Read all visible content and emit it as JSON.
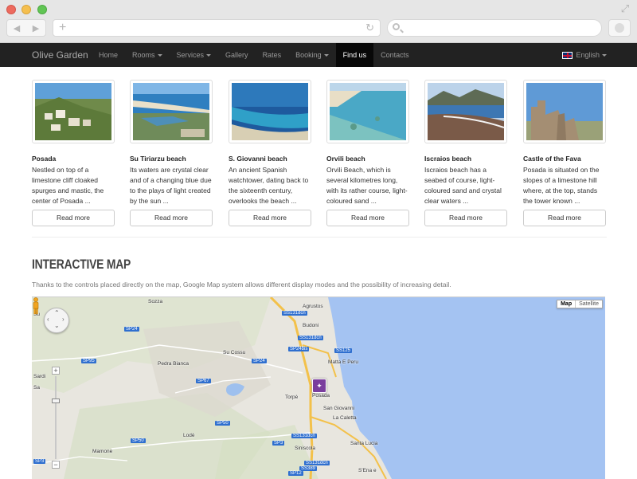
{
  "browser": {
    "nav_back": "◀",
    "nav_forward": "▶",
    "url_plus": "+",
    "reload_icon": "↻"
  },
  "navbar": {
    "brand": "Olive Garden",
    "items": [
      {
        "label": "Home",
        "dropdown": false,
        "active": false
      },
      {
        "label": "Rooms",
        "dropdown": true,
        "active": false
      },
      {
        "label": "Services",
        "dropdown": true,
        "active": false
      },
      {
        "label": "Gallery",
        "dropdown": false,
        "active": false
      },
      {
        "label": "Rates",
        "dropdown": false,
        "active": false
      },
      {
        "label": "Booking",
        "dropdown": true,
        "active": false
      },
      {
        "label": "Find us",
        "dropdown": false,
        "active": true
      },
      {
        "label": "Contacts",
        "dropdown": false,
        "active": false
      }
    ],
    "language": "English"
  },
  "cards": [
    {
      "title": "Posada",
      "text": "Nestled on top of a limestone cliff cloaked spurges and mastic, the center of Posada ...",
      "button": "Read more",
      "image": "hill-village"
    },
    {
      "title": "Su Tiriarzu beach",
      "text": "Its waters are crystal clear and of a changing blue due to the plays of light created by the sun ...",
      "button": "Read more",
      "image": "lagoon-beach"
    },
    {
      "title": "S. Giovanni beach",
      "text": "An ancient Spanish watchtower, dating back to the sixteenth century, overlooks the beach ...",
      "button": "Read more",
      "image": "sea-shore"
    },
    {
      "title": "Orvili beach",
      "text": "Orvili Beach, which is several kilometres long, with its rather course, light-coloured sand ...",
      "button": "Read more",
      "image": "clear-water"
    },
    {
      "title": "Iscraios beach",
      "text": "Iscraios beach has a seabed of course, light-coloured sand and crystal clear waters ...",
      "button": "Read more",
      "image": "mountain-beach"
    },
    {
      "title": "Castle of the Fava",
      "text": "Posada is situated on the slopes of a limestone hill where, at the top, stands the tower known ...",
      "button": "Read more",
      "image": "castle-ruins"
    }
  ],
  "map_section": {
    "title": "INTERACTIVE MAP",
    "subtitle": "Thanks to the controls placed directly on the map, Google Map system allows different display modes and the possibility of increasing detail.",
    "map_type": {
      "map": "Map",
      "satellite": "Satellite"
    },
    "zoom_in": "+",
    "zoom_out": "−",
    "places": [
      {
        "label": "Sozza"
      },
      {
        "label": "Agrustos"
      },
      {
        "label": "Budoni"
      },
      {
        "label": "Su Cossu"
      },
      {
        "label": "Pedra Bianca"
      },
      {
        "label": "Matta E Peru"
      },
      {
        "label": "Torpè"
      },
      {
        "label": "Posada"
      },
      {
        "label": "San Giovanni"
      },
      {
        "label": "La Caletta"
      },
      {
        "label": "Lodè"
      },
      {
        "label": "Mamone"
      },
      {
        "label": "Siniscola"
      },
      {
        "label": "Santa Lucia"
      },
      {
        "label": "S'Ena e"
      },
      {
        "label": "Su"
      },
      {
        "label": "Sardi"
      },
      {
        "label": "Sa"
      }
    ],
    "roads": [
      "SS131dcn",
      "SP24",
      "SS131dcn",
      "SP24bis",
      "SS125",
      "SP95",
      "SP24",
      "SP67",
      "SP50",
      "SP50",
      "SP3",
      "SS131dcn",
      "SP3",
      "SS389",
      "SP12",
      "SS131dcn"
    ]
  },
  "colors": {
    "navbar": "#222222",
    "active_nav": "#080808",
    "sea": "#a4c3f2",
    "land": "#e8e6df",
    "marker": "#7a3e9d"
  }
}
